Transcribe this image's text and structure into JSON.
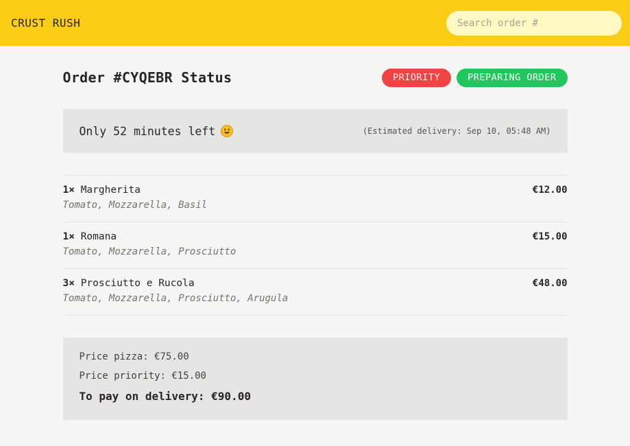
{
  "header": {
    "logo": "CRUST RUSH",
    "search_placeholder": "Search order #"
  },
  "order": {
    "title": "Order #CYQEBR Status",
    "badges": {
      "priority": "PRIORITY",
      "status": "PREPARING ORDER"
    },
    "colors": {
      "priority": "#ef4444",
      "status": "#22c55e",
      "header": "#facc15"
    }
  },
  "eta": {
    "time_left": "Only 52 minutes left",
    "estimated": "(Estimated delivery: Sep 10, 05:48 AM)",
    "icon": "smiley-icon"
  },
  "items": [
    {
      "qty": "1×",
      "name": "Margherita",
      "price": "€12.00",
      "ingredients": "Tomato, Mozzarella, Basil"
    },
    {
      "qty": "1×",
      "name": "Romana",
      "price": "€15.00",
      "ingredients": "Tomato, Mozzarella, Prosciutto"
    },
    {
      "qty": "3×",
      "name": "Prosciutto e Rucola",
      "price": "€48.00",
      "ingredients": "Tomato, Mozzarella, Prosciutto, Arugula"
    }
  ],
  "summary": {
    "price_pizza": "Price pizza: €75.00",
    "price_priority": "Price priority: €15.00",
    "total": "To pay on delivery: €90.00"
  }
}
